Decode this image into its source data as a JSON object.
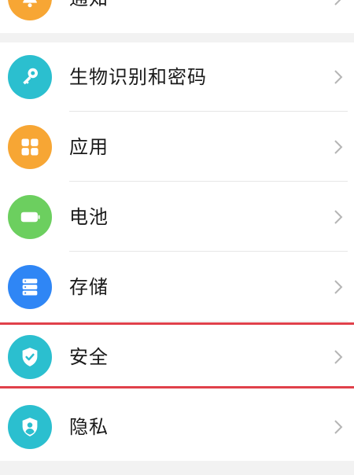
{
  "colors": {
    "notify": "#f7a634",
    "biometric": "#2bbfcf",
    "apps": "#f7a634",
    "battery": "#6ccf5f",
    "storage": "#2f86f5",
    "security": "#2bbfcf",
    "privacy": "#2bbfcf",
    "highlight": "#e0404a"
  },
  "settings": {
    "top_item": {
      "label": "通知",
      "icon": "bell-icon"
    },
    "items": [
      {
        "label": "生物识别和密码",
        "icon": "key-icon"
      },
      {
        "label": "应用",
        "icon": "apps-grid-icon"
      },
      {
        "label": "电池",
        "icon": "battery-icon"
      },
      {
        "label": "存储",
        "icon": "storage-icon"
      },
      {
        "label": "安全",
        "icon": "shield-check-icon"
      },
      {
        "label": "隐私",
        "icon": "privacy-shield-icon"
      }
    ]
  }
}
